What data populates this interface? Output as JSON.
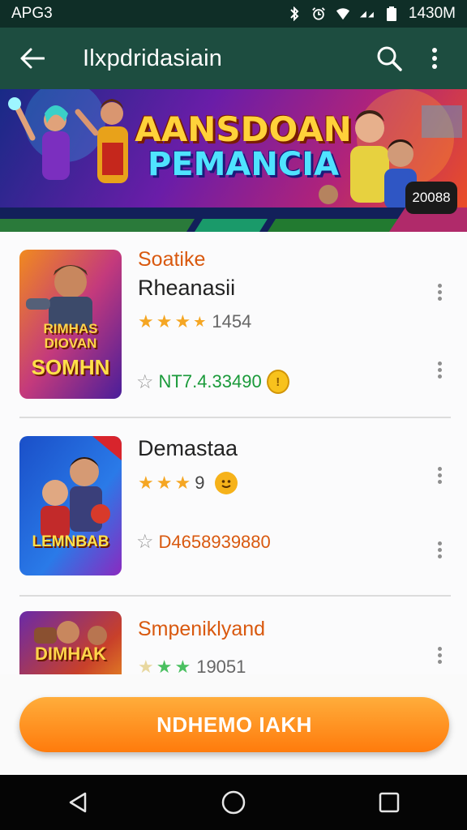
{
  "status_bar": {
    "carrier": "APG3",
    "time": "1430M"
  },
  "app_bar": {
    "title": "Ilxpdridasiain"
  },
  "banner": {
    "line1": "AANSDOAN",
    "line2": "PEMANCIA",
    "badge": "20088"
  },
  "items": [
    {
      "tag": "Soatike",
      "title": "Rheanasii",
      "rating_count": "1454",
      "price": "NT7.4.33490",
      "coin_symbol": "!"
    },
    {
      "title": "Demastaa",
      "rating_count": "9",
      "price": "D4658939880"
    },
    {
      "title": "Smpeniklyand",
      "rating_count": "19051"
    }
  ],
  "thumbs": [
    {
      "line1": "RIMHAS",
      "line2": "DIOVAN",
      "line3": "SOMHN"
    },
    {
      "line1": "LEMNBAB"
    },
    {
      "line1": "DIMHAK"
    }
  ],
  "cta": {
    "label": "NDHEMO IAKH"
  },
  "colors": {
    "app_bar": "#1d4d40",
    "status_bar": "#0f2e27",
    "accent_orange": "#ff8a1c",
    "price_green": "#1a9a3a",
    "star": "#f5a623"
  }
}
